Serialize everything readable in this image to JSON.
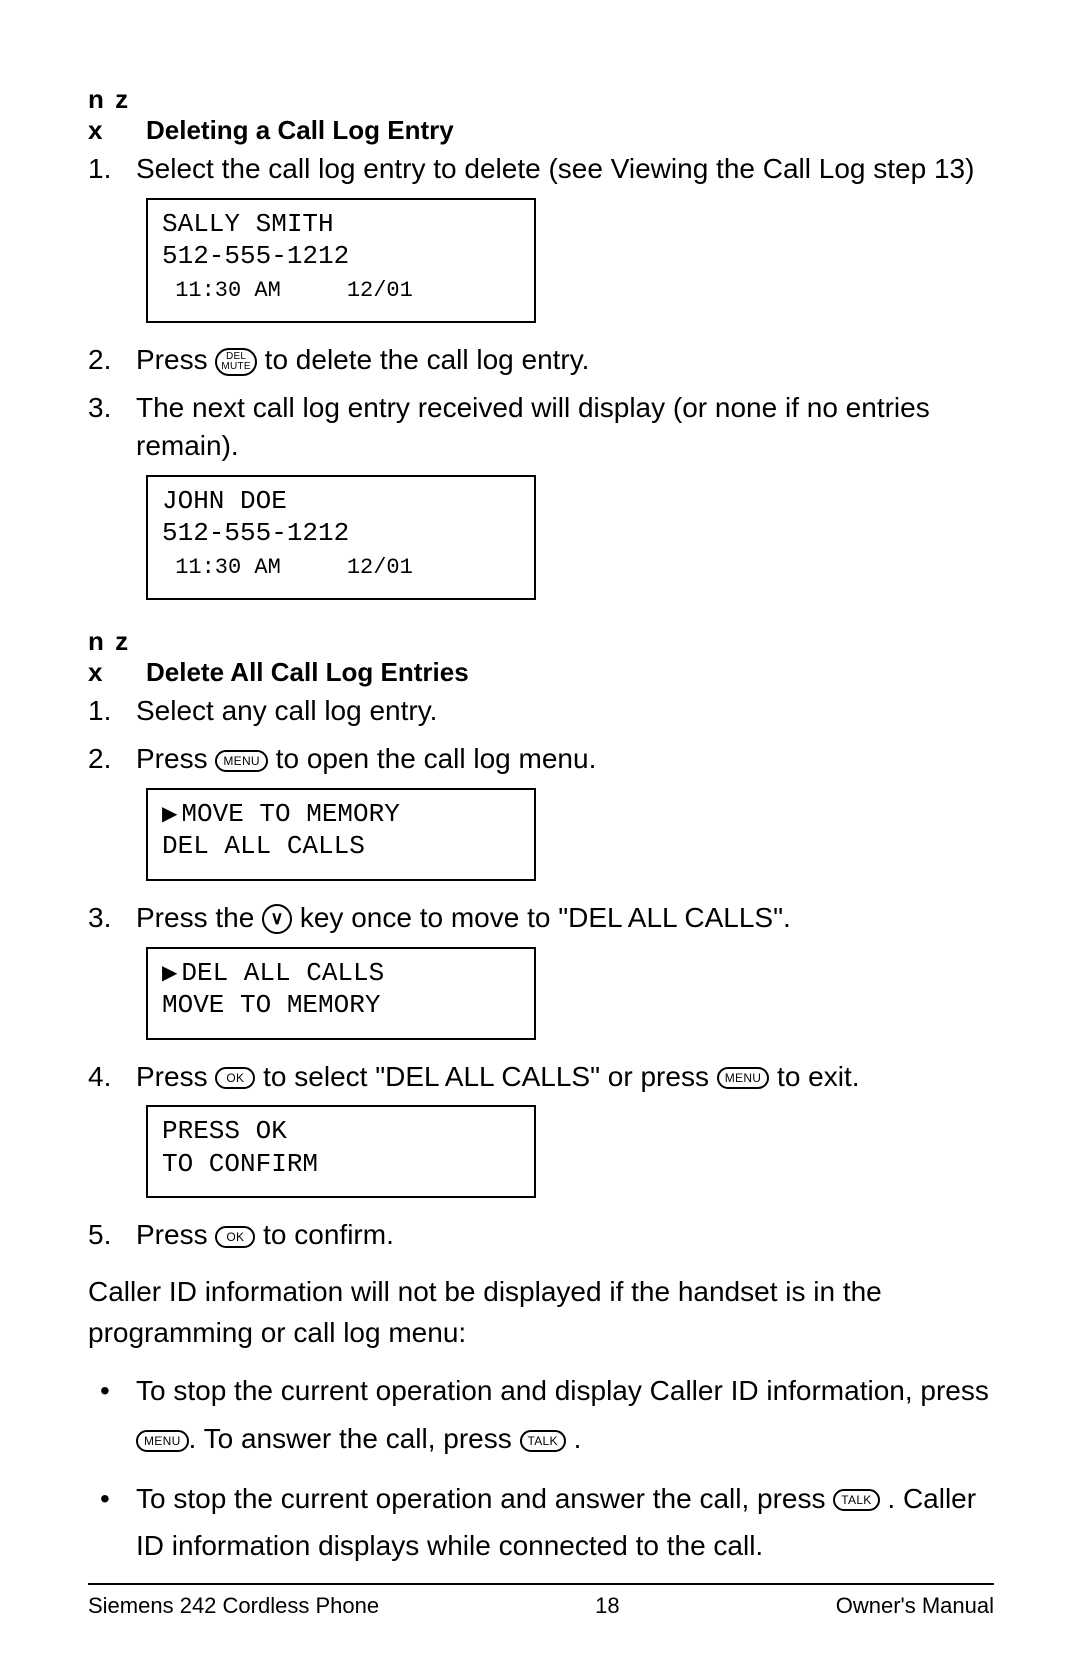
{
  "heading1_prefix": "n z x",
  "heading1": "Deleting a Call Log Entry",
  "sec1": {
    "s1": "Select the call log entry to delete (see Viewing the Call Log step 13)",
    "lcd1_l1": "SALLY SMITH",
    "lcd1_l2": "512-555-1212",
    "lcd1_l3": " 11:30 AM     12/01",
    "s2_a": "Press ",
    "s2_btn_top": "DEL",
    "s2_btn_bot": "MUTE",
    "s2_b": " to delete the call log entry.",
    "s3": "The next call log entry received will display (or none if no entries remain).",
    "lcd2_l1": "JOHN DOE",
    "lcd2_l2": "512-555-1212",
    "lcd2_l3": " 11:30 AM     12/01"
  },
  "heading2_prefix": "n z x",
  "heading2": "Delete All Call Log Entries",
  "sec2": {
    "s1": "Select any call log entry.",
    "s2_a": "Press ",
    "s2_btn": "MENU",
    "s2_b": " to open the call log menu.",
    "lcd1_l1": "MOVE TO MEMORY",
    "lcd1_l2": "DEL ALL CALLS",
    "s3_a": "Press the ",
    "s3_btn": "∨",
    "s3_b": " key once to move to \"DEL ALL CALLS\".",
    "lcd2_l1": "DEL ALL CALLS",
    "lcd2_l2": "MOVE TO MEMORY",
    "s4_a": "Press ",
    "s4_btn1": "OK",
    "s4_b": " to select \"DEL ALL CALLS\" or press ",
    "s4_btn2": "MENU",
    "s4_c": " to exit.",
    "lcd3_l1": "PRESS OK",
    "lcd3_l2": "TO CONFIRM",
    "s5_a": "Press ",
    "s5_btn": "OK",
    "s5_b": " to confirm."
  },
  "para1": "Caller ID information will not be displayed if the handset is in the programming or call log menu:",
  "bul1_a": "To stop the current operation and display Caller ID information, press ",
  "bul1_btn1": "MENU",
  "bul1_b": ". To answer the call, press ",
  "bul1_btn2": "TALK",
  "bul1_c": " .",
  "bul2_a": "To stop the current operation and answer the call, press ",
  "bul2_btn": "TALK",
  "bul2_b": " . Caller ID information displays while connected to the call.",
  "footer_left": "Siemens 242 Cordless Phone",
  "footer_center": "18",
  "footer_right": "Owner's Manual"
}
